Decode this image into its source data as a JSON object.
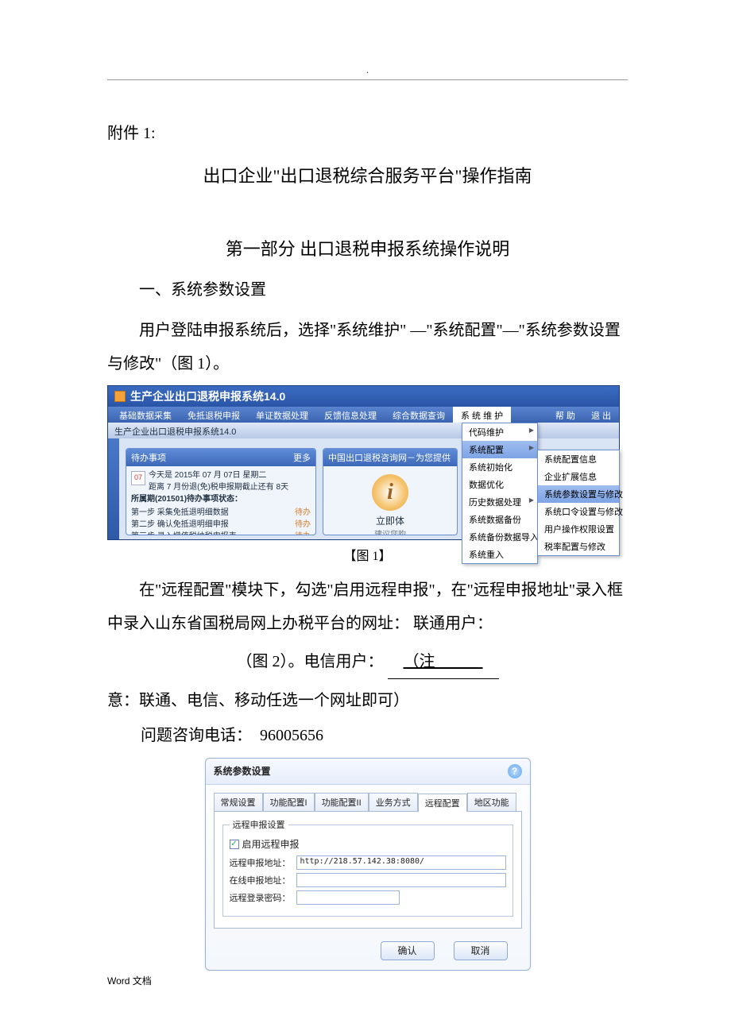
{
  "header_dot": ".",
  "attachment": "附件 1:",
  "main_title": "出口企业\"出口退税综合服务平台\"操作指南",
  "part_title": "第一部分   出口退税申报系统操作说明",
  "section1_title": "一、系统参数设置",
  "para1": "用户登陆申报系统后，选择\"系统维护\" —\"系统配置\"—\"系统参数设置与修改\"（图 1）。",
  "fig1_caption": "【图 1】",
  "para2_a": "在\"远程配置\"模块下，勾选\"启用远程申报\"，在\"远程申报地址\"录入框中录入山东省国税局网上办税平台的网址：  联通用户：",
  "para2_b": "（图 2）。电信用户：  ",
  "para2_c": "（注",
  "para3": "意：联通、电信、移动任选一个网址即可）",
  "phone_label": "问题咨询电话：",
  "phone_number": "96005656",
  "footer_text": "Word 文档",
  "ss1": {
    "title": "生产企业出口退税申报系统14.0",
    "menu": [
      "基础数据采集",
      "免抵退税申报",
      "单证数据处理",
      "反馈信息处理",
      "综合数据查询",
      "系 统 维 护",
      "帮  助",
      "退  出"
    ],
    "toolbar2": "生产企业出口退税申报系统14.0",
    "panel1": {
      "title": "待办事项",
      "more": "更多",
      "line1": "今天是 2015年 07 月 07日 星期二",
      "line2": "距离 7 月份退(免)税申报期截止还有 8天",
      "subhead": "所属期(201501)待办事项状态：",
      "steps": [
        "第一步  采集免抵退明细数据",
        "第二步  确认免抵退明细申报",
        "第三步  录入增值税纳税申报表"
      ],
      "pending": "待办"
    },
    "panel2": {
      "title": "中国出口退税咨询网－为您提供",
      "big": "立即体",
      "small": "建议您购"
    },
    "dd1": [
      "代码维护",
      "系统配置",
      "系统初始化",
      "数据优化",
      "历史数据处理",
      "系统数据备份",
      "系统备份数据导入",
      "系统重入"
    ],
    "dd2": [
      "系统配置信息",
      "企业扩展信息",
      "系统参数设置与修改",
      "系统口令设置与修改",
      "用户操作权限设置",
      "税率配置与修改"
    ]
  },
  "ss2": {
    "title": "系统参数设置",
    "tabs": [
      "常规设置",
      "功能配置I",
      "功能配置II",
      "业务方式",
      "远程配置",
      "地区功能"
    ],
    "fieldset_legend": "远程申报设置",
    "checkbox_label": "启用远程申报",
    "checkbox_checked": "✓",
    "rows": {
      "r1_label": "远程申报地址：",
      "r1_value": "http://218.57.142.38:8080/",
      "r2_label": "在线申报地址：",
      "r2_value": "",
      "r3_label": "远程登录密码：",
      "r3_value": ""
    },
    "btn_ok": "确认",
    "btn_cancel": "取消"
  }
}
